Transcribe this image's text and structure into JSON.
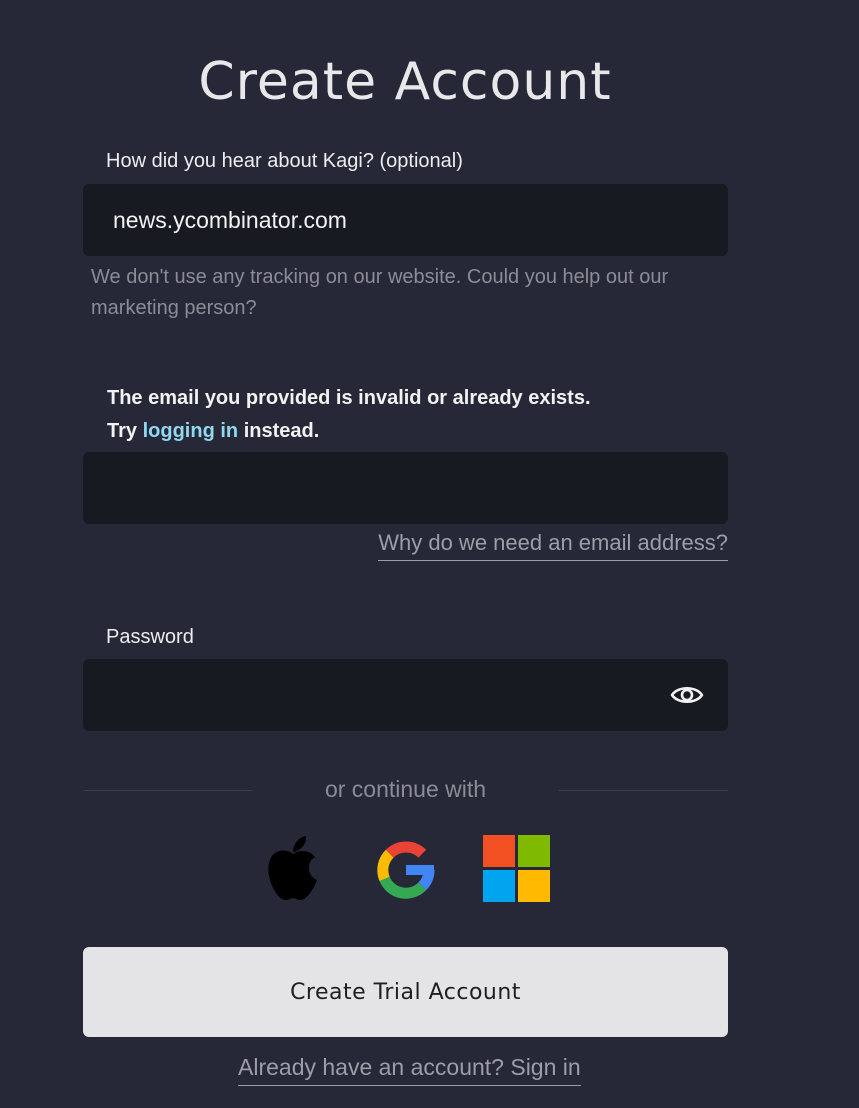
{
  "page": {
    "title": "Create Account"
  },
  "referral": {
    "label": "How did you hear about Kagi? (optional)",
    "value": "news.ycombinator.com",
    "hint": "We don't use any tracking on our website. Could you help out our marketing person?"
  },
  "email": {
    "error_line1": "The email you provided is invalid or already exists.",
    "error_try": "Try",
    "error_link": "logging in",
    "error_after": "instead.",
    "value": "",
    "help_link": "Why do we need an email address?"
  },
  "password": {
    "label": "Password",
    "value": "",
    "toggle_icon": "eye-icon"
  },
  "sso": {
    "divider_text": "or continue with",
    "providers": [
      {
        "name": "apple",
        "icon": "apple-icon"
      },
      {
        "name": "google",
        "icon": "google-icon"
      },
      {
        "name": "microsoft",
        "icon": "microsoft-icon"
      }
    ]
  },
  "actions": {
    "submit_label": "Create Trial Account",
    "signin_link": "Already have an account? Sign in"
  },
  "colors": {
    "background": "#262837",
    "field_bg": "#181a22",
    "link_accent": "#8fd8ef",
    "button_bg": "#e4e4e6"
  }
}
